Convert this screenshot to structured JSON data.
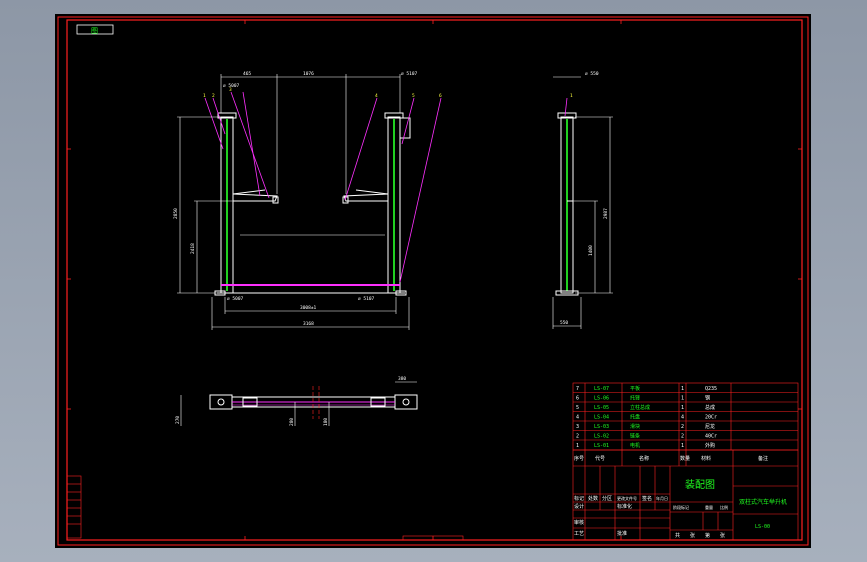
{
  "title_tag": "图",
  "colors": {
    "frame": "#ff2020",
    "line": "#ffffff",
    "column": "#20d020",
    "leader": "#ff30ff",
    "accent": "#ffff40",
    "text": "#ffffff",
    "grid": "#ff2020"
  },
  "front_view": {
    "dims": {
      "d_top_left": "465",
      "d_top_mid": "1076",
      "d_top_right": "⌀ 5107",
      "d_dia_left": "⌀ 5007",
      "d_height_total": "2850",
      "d_height_mid": "2418",
      "d_bottom_left": "⌀ 5007",
      "d_bottom_right": "⌀ 5107",
      "d_span_inner": "3008±1",
      "d_span_total": "3168"
    },
    "balloons": [
      "1",
      "2",
      "3",
      "4",
      "5",
      "6"
    ]
  },
  "side_view": {
    "dims": {
      "d_top": "⌀ 550",
      "d_height": "2987",
      "d_mid": "1400",
      "d_base": "550"
    },
    "balloons": [
      "1"
    ]
  },
  "top_view": {
    "dims": {
      "d_width": "380",
      "d_right": "300",
      "d_side": "270",
      "d_center_a": "280",
      "d_center_b": "180"
    }
  },
  "bom": {
    "rows": [
      {
        "no": "7",
        "code": "LS-07",
        "name": "平板",
        "qty": "1",
        "mat": "Q235",
        "note": ""
      },
      {
        "no": "6",
        "code": "LS-06",
        "name": "托臂",
        "qty": "1",
        "mat": "钢",
        "note": ""
      },
      {
        "no": "5",
        "code": "LS-05",
        "name": "立柱总成",
        "qty": "1",
        "mat": "总成",
        "note": ""
      },
      {
        "no": "4",
        "code": "LS-04",
        "name": "托盘",
        "qty": "4",
        "mat": "20Cr",
        "note": ""
      },
      {
        "no": "3",
        "code": "LS-03",
        "name": "滑块",
        "qty": "2",
        "mat": "尼龙",
        "note": ""
      },
      {
        "no": "2",
        "code": "LS-02",
        "name": "链条",
        "qty": "2",
        "mat": "40Cr",
        "note": ""
      },
      {
        "no": "1",
        "code": "LS-01",
        "name": "电机",
        "qty": "1",
        "mat": "外购",
        "note": ""
      }
    ],
    "header": {
      "no": "序号",
      "code": "代号",
      "name": "名称",
      "qty": "数量",
      "mat": "材料",
      "weight": "重量",
      "note": "备注"
    }
  },
  "title_block": {
    "drawing_title": "装配图",
    "product_name": "双柱式汽车举升机",
    "drawing_no": "LS-00",
    "labels": {
      "mark": "标记",
      "count": "处数",
      "zone": "分区",
      "change": "更改文件号",
      "sign": "签名",
      "date": "年月日",
      "design": "设计",
      "standard": "标准化",
      "review": "审核",
      "process": "工艺",
      "approve": "批准",
      "stage": "阶段标记",
      "weight": "重量",
      "scale": "比例",
      "sheet_a": "共",
      "sheet_b": "张",
      "sheet_c": "第",
      "sheet_d": "张"
    }
  }
}
